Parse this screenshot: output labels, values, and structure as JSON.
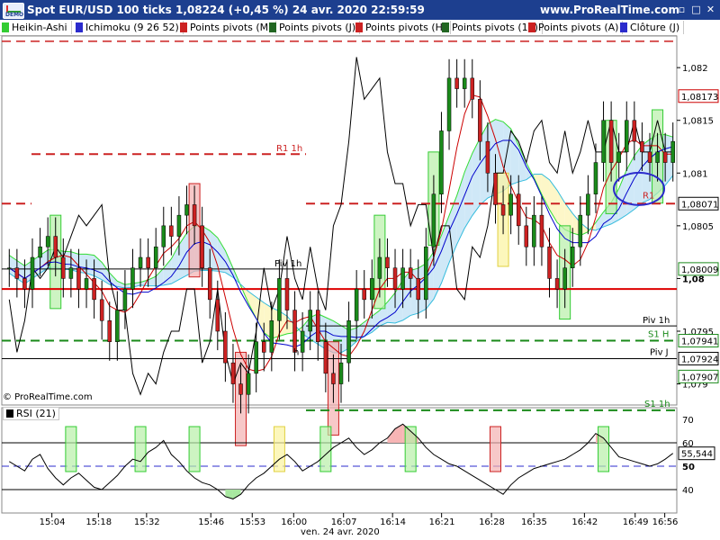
{
  "window": {
    "title": "Spot EUR/USD 100 ticks 1,08224 (+0,45 %) 24 avr. 2020 22:59:59",
    "website": "www.ProRealTime.com",
    "logo_text": "DEMO"
  },
  "legend": [
    {
      "label": "Heikin-Ashi",
      "color": "#33cc33"
    },
    {
      "label": "Ichimoku (9 26 52)",
      "color": "#2b2bcc"
    },
    {
      "label": "Points pivots (M)",
      "color": "#cc2222"
    },
    {
      "label": "Points pivots (J)",
      "color": "#226622"
    },
    {
      "label": "Points pivots (H)",
      "color": "#cc2222"
    },
    {
      "label": "Points pivots (1h)",
      "color": "#226622"
    },
    {
      "label": "Points pivots (A)",
      "color": "#cc2222"
    },
    {
      "label": "Clôture (J)",
      "color": "#2b2bcc"
    }
  ],
  "price_axis": {
    "ticks": [
      "1,082",
      "1,0815",
      "1,081",
      "1,0805",
      "1,08",
      "1,0795",
      "1,079"
    ],
    "highlighted": [
      {
        "text": "1,08173",
        "color": "#cc0000"
      },
      {
        "text": "1,08071",
        "color": "#000000"
      },
      {
        "text": "1,08009",
        "color": "#1a8a1a"
      },
      {
        "text": "1,07941",
        "color": "#1a8a1a"
      },
      {
        "text": "1,07924",
        "color": "#000000"
      },
      {
        "text": "1,07907",
        "color": "#1a8a1a"
      }
    ]
  },
  "pivot_labels": {
    "r1_1h_left": "R1 1h",
    "r1_right": "R1",
    "piv_1h_left": "Piv 1h",
    "piv_1h_right": "Piv 1h",
    "s1_h": "S1 H",
    "piv_j": "Piv J",
    "s1_1h": "S1 1h",
    "h_small": "h"
  },
  "time_axis": {
    "ticks": [
      "15:04",
      "15:18",
      "15:32",
      "15:46",
      "15:53",
      "16:00",
      "16:07",
      "16:14",
      "16:21",
      "16:28",
      "16:35",
      "16:42",
      "16:49",
      "16:56"
    ],
    "date": "ven. 24 avr. 2020"
  },
  "rsi": {
    "label": "RSI (21)",
    "ticks": [
      "70",
      "60",
      "50",
      "40"
    ],
    "current": "55,544"
  },
  "copyright": "© ProRealTime.com",
  "colors": {
    "titlebar": "#1d3f8f",
    "bull": "#1a8a1a",
    "bear": "#cc2222",
    "tenkan": "#cc0000",
    "kijun": "#0000cc",
    "chikou": "#000000",
    "kumo_bull": "#cfe8f7",
    "kumo_bear": "#fdf7c8"
  },
  "chart_data": {
    "type": "candlestick",
    "title": "Spot EUR/USD 100 ticks",
    "ylim": [
      1.0788,
      1.0823
    ],
    "price": [
      1.0801,
      1.08,
      1.0799,
      1.0802,
      1.0803,
      1.0804,
      1.0802,
      1.08,
      1.0801,
      1.0799,
      1.08,
      1.0798,
      1.0796,
      1.0794,
      1.0797,
      1.0799,
      1.0801,
      1.0802,
      1.0801,
      1.0803,
      1.0805,
      1.0804,
      1.0806,
      1.0807,
      1.0805,
      1.0801,
      1.0798,
      1.0795,
      1.0792,
      1.079,
      1.0789,
      1.0791,
      1.0794,
      1.0793,
      1.0796,
      1.08,
      1.0797,
      1.0793,
      1.0795,
      1.0797,
      1.0794,
      1.0791,
      1.079,
      1.0792,
      1.0796,
      1.0799,
      1.0798,
      1.08,
      1.0802,
      1.0801,
      1.0799,
      1.0801,
      1.08,
      1.0798,
      1.0803,
      1.0808,
      1.0814,
      1.0819,
      1.0818,
      1.0819,
      1.0817,
      1.0813,
      1.081,
      1.0807,
      1.0806,
      1.0808,
      1.0805,
      1.0803,
      1.0806,
      1.0803,
      1.08,
      1.0799,
      1.0801,
      1.0803,
      1.0806,
      1.0808,
      1.0811,
      1.0815,
      1.0811,
      1.0812,
      1.0815,
      1.0813,
      1.0812,
      1.0811,
      1.0812,
      1.0811,
      1.0813
    ],
    "rsi": [
      52,
      50,
      48,
      53,
      55,
      49,
      45,
      42,
      45,
      47,
      44,
      41,
      40,
      43,
      46,
      50,
      53,
      52,
      56,
      58,
      61,
      55,
      52,
      48,
      45,
      43,
      42,
      40,
      37,
      36,
      38,
      42,
      45,
      47,
      50,
      53,
      55,
      52,
      48,
      50,
      52,
      55,
      58,
      60,
      62,
      58,
      55,
      57,
      60,
      62,
      66,
      68,
      65,
      62,
      58,
      55,
      53,
      51,
      50,
      48,
      46,
      44,
      42,
      40,
      38,
      42,
      45,
      47,
      49,
      50,
      51,
      52,
      53,
      55,
      57,
      60,
      64,
      62,
      58,
      54,
      53,
      52,
      51,
      50,
      51,
      53,
      55.5
    ],
    "rsi_ylim": [
      30,
      75
    ]
  }
}
